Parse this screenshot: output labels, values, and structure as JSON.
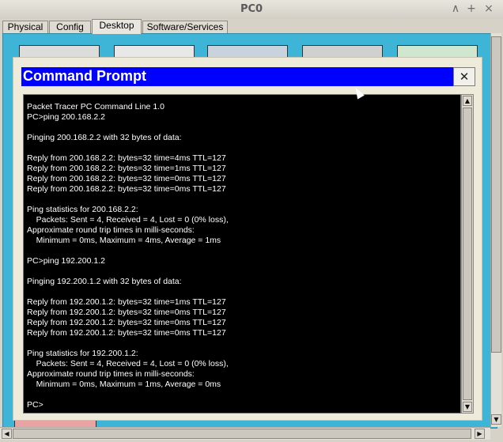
{
  "window": {
    "title": "PC0",
    "controls": [
      "∧",
      "+",
      "×"
    ]
  },
  "tabs": [
    {
      "label": "Physical"
    },
    {
      "label": "Config"
    },
    {
      "label": "Desktop",
      "active": true
    },
    {
      "label": "Software/Services"
    }
  ],
  "command_prompt": {
    "title": "Command Prompt",
    "close_label": "X",
    "lines": [
      "Packet Tracer PC Command Line 1.0",
      "PC>ping 200.168.2.2",
      "",
      "Pinging 200.168.2.2 with 32 bytes of data:",
      "",
      "Reply from 200.168.2.2: bytes=32 time=4ms TTL=127",
      "Reply from 200.168.2.2: bytes=32 time=1ms TTL=127",
      "Reply from 200.168.2.2: bytes=32 time=0ms TTL=127",
      "Reply from 200.168.2.2: bytes=32 time=0ms TTL=127",
      "",
      "Ping statistics for 200.168.2.2:",
      "    Packets: Sent = 4, Received = 4, Lost = 0 (0% loss),",
      "Approximate round trip times in milli-seconds:",
      "    Minimum = 0ms, Maximum = 4ms, Average = 1ms",
      "",
      "PC>ping 192.200.1.2",
      "",
      "Pinging 192.200.1.2 with 32 bytes of data:",
      "",
      "Reply from 192.200.1.2: bytes=32 time=1ms TTL=127",
      "Reply from 192.200.1.2: bytes=32 time=0ms TTL=127",
      "Reply from 192.200.1.2: bytes=32 time=0ms TTL=127",
      "Reply from 192.200.1.2: bytes=32 time=0ms TTL=127",
      "",
      "Ping statistics for 192.200.1.2:",
      "    Packets: Sent = 4, Received = 4, Lost = 0 (0% loss),",
      "Approximate round trip times in milli-seconds:",
      "    Minimum = 0ms, Maximum = 1ms, Average = 0ms",
      "",
      "PC>"
    ]
  },
  "colors": {
    "desktop_bg": "#3eb5d6",
    "cmd_titlebar": "#0000ff",
    "terminal_bg": "#000000",
    "terminal_text": "#ffffff"
  },
  "icons": {
    "win_minimize": "chevron-up-icon",
    "win_maximize": "plus-icon",
    "win_close": "close-icon",
    "scroll_up": "arrow-up-icon",
    "scroll_down": "arrow-down-icon",
    "scroll_left": "arrow-left-icon",
    "scroll_right": "arrow-right-icon"
  }
}
